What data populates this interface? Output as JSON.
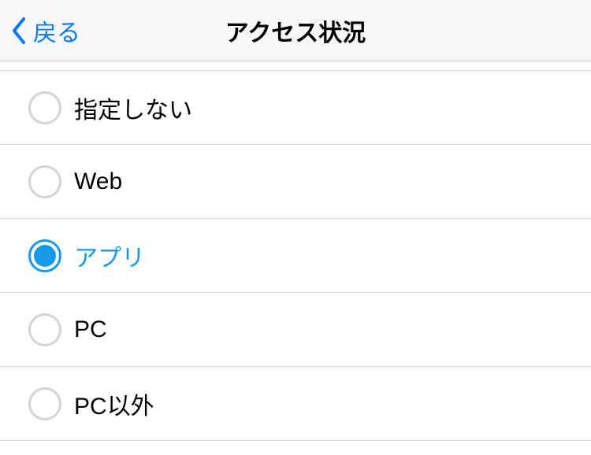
{
  "header": {
    "back_label": "戻る",
    "title": "アクセス状況"
  },
  "options": [
    {
      "label": "指定しない",
      "selected": false
    },
    {
      "label": "Web",
      "selected": false
    },
    {
      "label": "アプリ",
      "selected": true
    },
    {
      "label": "PC",
      "selected": false
    },
    {
      "label": "PC以外",
      "selected": false
    }
  ]
}
